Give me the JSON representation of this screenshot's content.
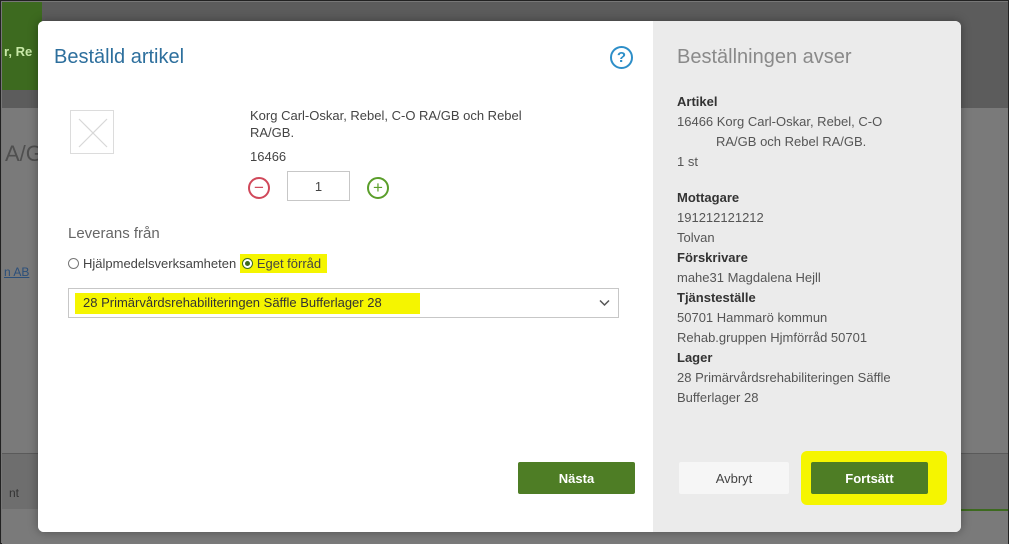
{
  "background": {
    "green_snippet": "r, Re",
    "big_snippet": "A/G",
    "link_snippet": "n AB",
    "bottom_snippet": "nt"
  },
  "modal": {
    "title": "Beställd artikel",
    "help_glyph": "?",
    "article": {
      "name": "Korg Carl-Oskar, Rebel, C-O RA/GB och Rebel RA/GB.",
      "number": "16466",
      "quantity": "1"
    },
    "delivery": {
      "label": "Leverans från",
      "options": [
        "Hjälpmedelsverksamheten",
        "Eget förråd"
      ],
      "selected": "Eget förråd",
      "warehouse_select": "28 Primärvårdsrehabiliteringen Säffle Bufferlager 28"
    },
    "next_label": "Nästa"
  },
  "summary": {
    "title": "Beställningen avser",
    "artikel_heading": "Artikel",
    "artikel_line1": "16466 Korg Carl-Oskar, Rebel, C-O",
    "artikel_line2": "RA/GB och Rebel RA/GB.",
    "artikel_qty": "1 st",
    "mottagare_heading": "Mottagare",
    "mottagare_id": "191212121212",
    "mottagare_name": "Tolvan",
    "forskrivare_heading": "Förskrivare",
    "forskrivare_value": "mahe31 Magdalena Hejll",
    "tjanstestalle_heading": "Tjänsteställe",
    "tjanstestalle_line1": "50701 Hammarö kommun",
    "tjanstestalle_line2": "Rehab.gruppen Hjmförråd 50701",
    "lager_heading": "Lager",
    "lager_line1": "28 Primärvårdsrehabiliteringen Säffle",
    "lager_line2": "Bufferlager 28",
    "cancel_label": "Avbryt",
    "continue_label": "Fortsätt"
  },
  "colors": {
    "primary_green": "#4e7d25",
    "title_blue": "#2d6f9d",
    "highlight_yellow": "#f5f500",
    "minus_red": "#d0485a",
    "plus_green": "#5a9e2a"
  }
}
